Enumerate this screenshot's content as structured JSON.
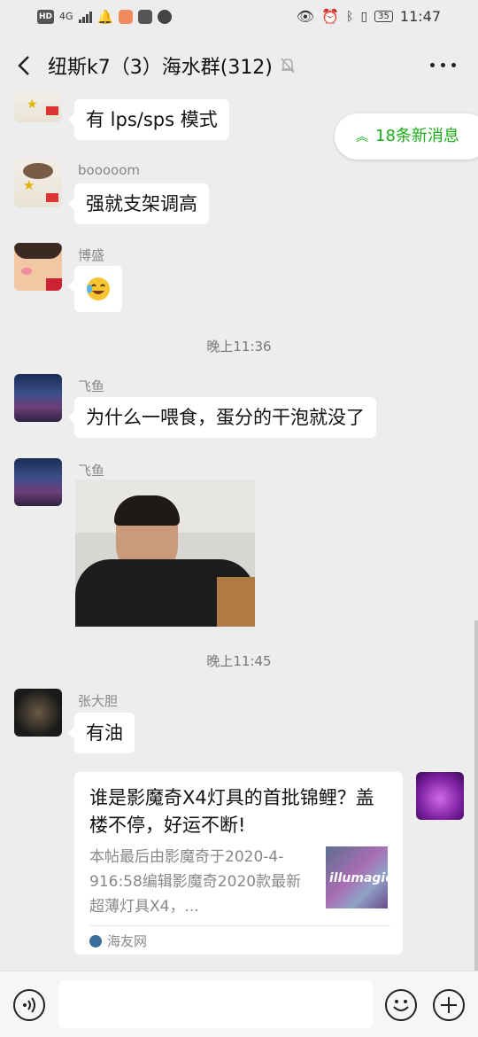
{
  "status_bar": {
    "network": "4G",
    "hd": "HD",
    "battery": "35",
    "time": "11:47"
  },
  "header": {
    "title": "纽斯k7（3）海水群(312)"
  },
  "new_messages": {
    "label": "18条新消息"
  },
  "messages": [
    {
      "sender": "",
      "text": "有 lps/sps 模式"
    },
    {
      "sender": "booooom",
      "text": "强就支架调高"
    },
    {
      "sender": "博盛",
      "text": ""
    },
    {
      "sender": "飞鱼",
      "text": "为什么一喂食，蛋分的干泡就没了"
    },
    {
      "sender": "飞鱼",
      "text": ""
    },
    {
      "sender": "张大胆",
      "text": "有油"
    }
  ],
  "timestamps": [
    "晚上11:36",
    "晚上11:45"
  ],
  "link_card": {
    "title": "谁是影魔奇X4灯具的首批锦鲤？盖楼不停，好运不断!",
    "description": "本帖最后由影魔奇于2020-4-916:58编辑影魔奇2020款最新超薄灯具X4，...",
    "thumb_text": "illumagic",
    "source": "海友网"
  },
  "colors": {
    "accent": "#1aad19",
    "background": "#ededed",
    "bubble": "#ffffff"
  }
}
